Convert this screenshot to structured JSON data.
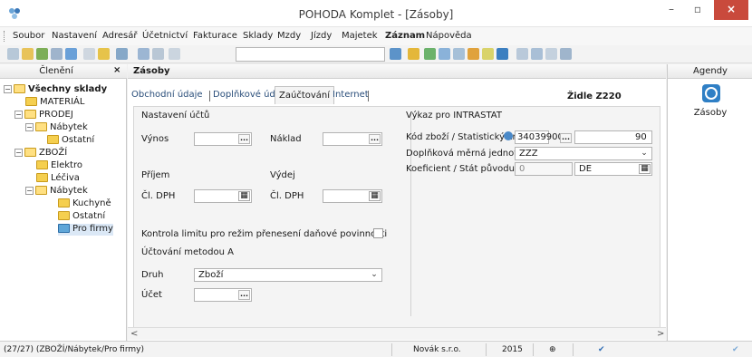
{
  "window": {
    "title": "POHODA Komplet - [Zásoby]",
    "btn_min": "–",
    "btn_max": "▫",
    "btn_close": "×"
  },
  "menu": [
    "Soubor",
    "Nastavení",
    "Adresář",
    "Účetnictví",
    "Fakturace",
    "Sklady",
    "Mzdy",
    "Jízdy",
    "Majetek",
    "Záznam",
    "Nápověda"
  ],
  "left_panel": {
    "title": "Členění",
    "close": "×",
    "tree": [
      {
        "label": "Všechny sklady",
        "exp": "−",
        "bold": true
      },
      {
        "label": "MATERIÁL",
        "exp": ""
      },
      {
        "label": "PRODEJ",
        "exp": "−"
      },
      {
        "label": "Nábytek",
        "exp": "−"
      },
      {
        "label": "Ostatní",
        "exp": ""
      },
      {
        "label": "ZBOŽÍ",
        "exp": "−"
      },
      {
        "label": "Elektro",
        "exp": ""
      },
      {
        "label": "Léčiva",
        "exp": ""
      },
      {
        "label": "Nábytek",
        "exp": "−"
      },
      {
        "label": "Kuchyně",
        "exp": ""
      },
      {
        "label": "Ostatní",
        "exp": ""
      },
      {
        "label": "Pro firmy",
        "exp": ""
      }
    ]
  },
  "main": {
    "header": "Zásoby",
    "tabs": [
      "Obchodní údaje",
      "Doplňkové údaje",
      "Zaúčtování",
      "Internet"
    ],
    "product_name": "Židle Z220",
    "sections": {
      "accounts": "Nastavení účtů",
      "intrastat": "Výkaz pro INTRASTAT",
      "method": "Účtování metodou A"
    },
    "labels": {
      "vynos": "Výnos",
      "naklad": "Náklad",
      "prijem": "Příjem",
      "vydej": "Výdej",
      "cl_dph_1": "Čl. DPH",
      "cl_dph_2": "Čl. DPH",
      "kontrola": "Kontrola limitu pro režim přenesení daňové povinnosti",
      "druh": "Druh",
      "ucet": "Účet",
      "kod_zbozi": "Kód zboží / Statistický znak",
      "dopl_jednotka": "Doplňková měrná jednotka",
      "koeficient": "Koeficient / Stát původu"
    },
    "values": {
      "druh": "Zboží",
      "kod_zbozi": "34039900",
      "stat_znak": "90",
      "dopl_jednotka": "ZZZ",
      "koeficient": "0",
      "stat_puvodu": "DE"
    },
    "symbols": {
      "dots": "...",
      "calc": "▦",
      "arrow": "⌄",
      "left": "<",
      "right": ">"
    }
  },
  "right_panel": {
    "title": "Agendy",
    "item": "Zásoby"
  },
  "status": {
    "path": "(27/27) (ZBOŽÍ/Nábytek/Pro firmy)",
    "company": "Novák s.r.o.",
    "year": "2015",
    "glyph_1": "⊕",
    "glyph_2": "✔"
  },
  "colors": {
    "accent": "#2f7fc5",
    "close": "#c94a3c"
  }
}
